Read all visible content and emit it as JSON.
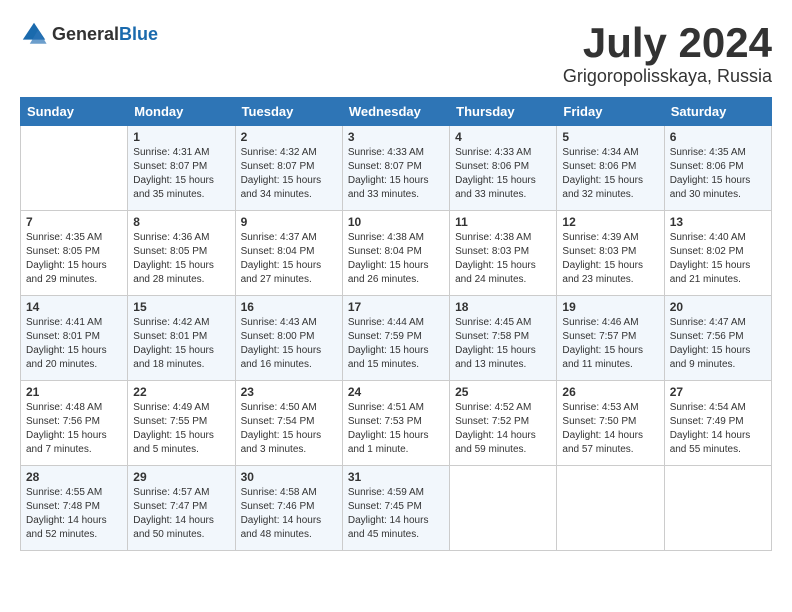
{
  "logo": {
    "general": "General",
    "blue": "Blue"
  },
  "title": "July 2024",
  "location": "Grigoropolisskaya, Russia",
  "weekdays": [
    "Sunday",
    "Monday",
    "Tuesday",
    "Wednesday",
    "Thursday",
    "Friday",
    "Saturday"
  ],
  "weeks": [
    [
      {
        "day": "",
        "info": ""
      },
      {
        "day": "1",
        "info": "Sunrise: 4:31 AM\nSunset: 8:07 PM\nDaylight: 15 hours\nand 35 minutes."
      },
      {
        "day": "2",
        "info": "Sunrise: 4:32 AM\nSunset: 8:07 PM\nDaylight: 15 hours\nand 34 minutes."
      },
      {
        "day": "3",
        "info": "Sunrise: 4:33 AM\nSunset: 8:07 PM\nDaylight: 15 hours\nand 33 minutes."
      },
      {
        "day": "4",
        "info": "Sunrise: 4:33 AM\nSunset: 8:06 PM\nDaylight: 15 hours\nand 33 minutes."
      },
      {
        "day": "5",
        "info": "Sunrise: 4:34 AM\nSunset: 8:06 PM\nDaylight: 15 hours\nand 32 minutes."
      },
      {
        "day": "6",
        "info": "Sunrise: 4:35 AM\nSunset: 8:06 PM\nDaylight: 15 hours\nand 30 minutes."
      }
    ],
    [
      {
        "day": "7",
        "info": "Sunrise: 4:35 AM\nSunset: 8:05 PM\nDaylight: 15 hours\nand 29 minutes."
      },
      {
        "day": "8",
        "info": "Sunrise: 4:36 AM\nSunset: 8:05 PM\nDaylight: 15 hours\nand 28 minutes."
      },
      {
        "day": "9",
        "info": "Sunrise: 4:37 AM\nSunset: 8:04 PM\nDaylight: 15 hours\nand 27 minutes."
      },
      {
        "day": "10",
        "info": "Sunrise: 4:38 AM\nSunset: 8:04 PM\nDaylight: 15 hours\nand 26 minutes."
      },
      {
        "day": "11",
        "info": "Sunrise: 4:38 AM\nSunset: 8:03 PM\nDaylight: 15 hours\nand 24 minutes."
      },
      {
        "day": "12",
        "info": "Sunrise: 4:39 AM\nSunset: 8:03 PM\nDaylight: 15 hours\nand 23 minutes."
      },
      {
        "day": "13",
        "info": "Sunrise: 4:40 AM\nSunset: 8:02 PM\nDaylight: 15 hours\nand 21 minutes."
      }
    ],
    [
      {
        "day": "14",
        "info": "Sunrise: 4:41 AM\nSunset: 8:01 PM\nDaylight: 15 hours\nand 20 minutes."
      },
      {
        "day": "15",
        "info": "Sunrise: 4:42 AM\nSunset: 8:01 PM\nDaylight: 15 hours\nand 18 minutes."
      },
      {
        "day": "16",
        "info": "Sunrise: 4:43 AM\nSunset: 8:00 PM\nDaylight: 15 hours\nand 16 minutes."
      },
      {
        "day": "17",
        "info": "Sunrise: 4:44 AM\nSunset: 7:59 PM\nDaylight: 15 hours\nand 15 minutes."
      },
      {
        "day": "18",
        "info": "Sunrise: 4:45 AM\nSunset: 7:58 PM\nDaylight: 15 hours\nand 13 minutes."
      },
      {
        "day": "19",
        "info": "Sunrise: 4:46 AM\nSunset: 7:57 PM\nDaylight: 15 hours\nand 11 minutes."
      },
      {
        "day": "20",
        "info": "Sunrise: 4:47 AM\nSunset: 7:56 PM\nDaylight: 15 hours\nand 9 minutes."
      }
    ],
    [
      {
        "day": "21",
        "info": "Sunrise: 4:48 AM\nSunset: 7:56 PM\nDaylight: 15 hours\nand 7 minutes."
      },
      {
        "day": "22",
        "info": "Sunrise: 4:49 AM\nSunset: 7:55 PM\nDaylight: 15 hours\nand 5 minutes."
      },
      {
        "day": "23",
        "info": "Sunrise: 4:50 AM\nSunset: 7:54 PM\nDaylight: 15 hours\nand 3 minutes."
      },
      {
        "day": "24",
        "info": "Sunrise: 4:51 AM\nSunset: 7:53 PM\nDaylight: 15 hours\nand 1 minute."
      },
      {
        "day": "25",
        "info": "Sunrise: 4:52 AM\nSunset: 7:52 PM\nDaylight: 14 hours\nand 59 minutes."
      },
      {
        "day": "26",
        "info": "Sunrise: 4:53 AM\nSunset: 7:50 PM\nDaylight: 14 hours\nand 57 minutes."
      },
      {
        "day": "27",
        "info": "Sunrise: 4:54 AM\nSunset: 7:49 PM\nDaylight: 14 hours\nand 55 minutes."
      }
    ],
    [
      {
        "day": "28",
        "info": "Sunrise: 4:55 AM\nSunset: 7:48 PM\nDaylight: 14 hours\nand 52 minutes."
      },
      {
        "day": "29",
        "info": "Sunrise: 4:57 AM\nSunset: 7:47 PM\nDaylight: 14 hours\nand 50 minutes."
      },
      {
        "day": "30",
        "info": "Sunrise: 4:58 AM\nSunset: 7:46 PM\nDaylight: 14 hours\nand 48 minutes."
      },
      {
        "day": "31",
        "info": "Sunrise: 4:59 AM\nSunset: 7:45 PM\nDaylight: 14 hours\nand 45 minutes."
      },
      {
        "day": "",
        "info": ""
      },
      {
        "day": "",
        "info": ""
      },
      {
        "day": "",
        "info": ""
      }
    ]
  ]
}
